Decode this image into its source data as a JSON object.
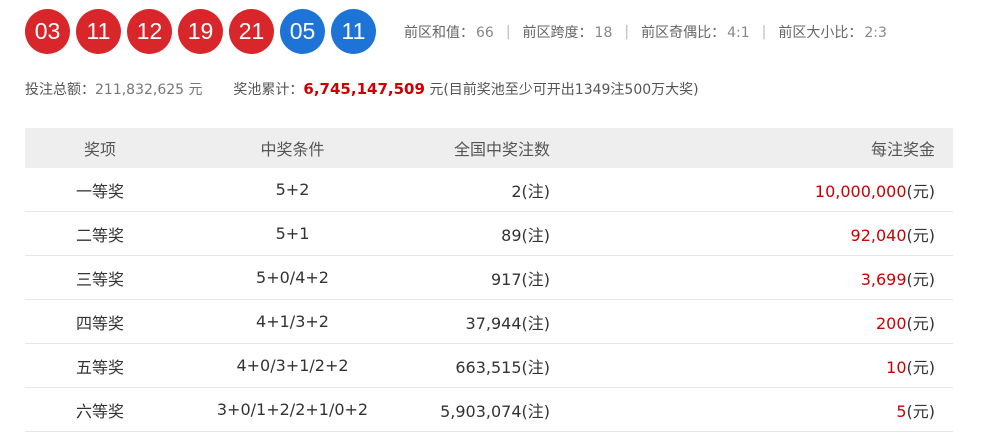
{
  "balls": {
    "front": [
      "03",
      "11",
      "12",
      "19",
      "21"
    ],
    "back": [
      "05",
      "11"
    ],
    "colors": {
      "front": "#d9262b",
      "back": "#1e73d6"
    }
  },
  "stats": [
    {
      "label": "前区和值：",
      "value": "66"
    },
    {
      "label": "前区跨度：",
      "value": "18"
    },
    {
      "label": "前区奇偶比：",
      "value": "4:1"
    },
    {
      "label": "前区大小比：",
      "value": "2:3"
    }
  ],
  "stat_separator": "|",
  "summary": {
    "sales_label": "投注总额：",
    "sales_value": "211,832,625 元",
    "pool_label": "奖池累计：",
    "pool_value": "6,745,147,509",
    "pool_unit": "元",
    "pool_note": "(目前奖池至少可开出1349注500万大奖)"
  },
  "table": {
    "headers": [
      "奖项",
      "中奖条件",
      "全国中奖注数",
      "每注奖金"
    ],
    "count_unit": "(注)",
    "amount_unit": "(元)",
    "rows": [
      {
        "level": "一等奖",
        "condition": "5+2",
        "count": "2",
        "amount": "10,000,000"
      },
      {
        "level": "二等奖",
        "condition": "5+1",
        "count": "89",
        "amount": "92,040"
      },
      {
        "level": "三等奖",
        "condition": "5+0/4+2",
        "count": "917",
        "amount": "3,699"
      },
      {
        "level": "四等奖",
        "condition": "4+1/3+2",
        "count": "37,944",
        "amount": "200"
      },
      {
        "level": "五等奖",
        "condition": "4+0/3+1/2+2",
        "count": "663,515",
        "amount": "10"
      },
      {
        "level": "六等奖",
        "condition": "3+0/1+2/2+1/0+2",
        "count": "5,903,074",
        "amount": "5"
      }
    ]
  }
}
